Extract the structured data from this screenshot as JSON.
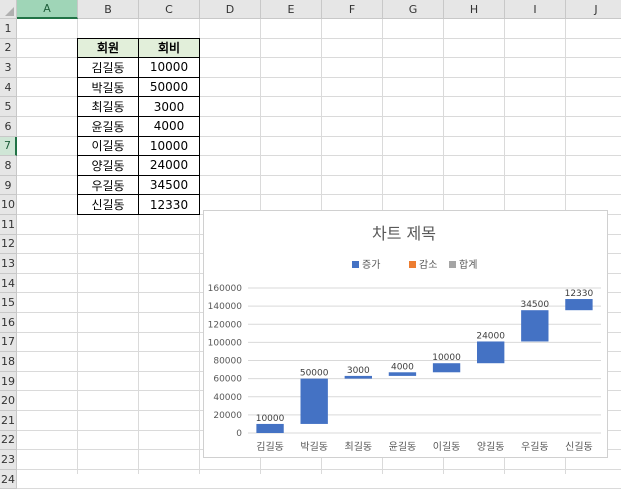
{
  "sheet": {
    "columns": [
      "A",
      "B",
      "C",
      "D",
      "E",
      "F",
      "G",
      "H",
      "I",
      "J"
    ],
    "rows": [
      "1",
      "2",
      "3",
      "4",
      "5",
      "6",
      "7",
      "8",
      "9",
      "10",
      "11",
      "12",
      "13",
      "14",
      "15",
      "16",
      "17",
      "18",
      "19",
      "20",
      "21",
      "22",
      "23",
      "24"
    ],
    "selected_column": "A",
    "selected_row": "7"
  },
  "table": {
    "header": [
      "회원",
      "회비"
    ],
    "rows": [
      [
        "김길동",
        "10000"
      ],
      [
        "박길동",
        "50000"
      ],
      [
        "최길동",
        "3000"
      ],
      [
        "윤길동",
        "4000"
      ],
      [
        "이길동",
        "10000"
      ],
      [
        "양길동",
        "24000"
      ],
      [
        "우길동",
        "34500"
      ],
      [
        "신길동",
        "12330"
      ]
    ]
  },
  "chart_data": {
    "type": "bar",
    "subtype": "waterfall",
    "title": "차트 제목",
    "legend": [
      {
        "name": "증가",
        "color": "#4472c4"
      },
      {
        "name": "감소",
        "color": "#ed7d31"
      },
      {
        "name": "합계",
        "color": "#a5a5a5"
      }
    ],
    "legend_position": "top",
    "categories": [
      "김길동",
      "박길동",
      "최길동",
      "윤길동",
      "이길동",
      "양길동",
      "우길동",
      "신길동"
    ],
    "values": [
      10000,
      50000,
      3000,
      4000,
      10000,
      24000,
      34500,
      12330
    ],
    "data_labels": [
      "10000",
      "50000",
      "3000",
      "4000",
      "10000",
      "24000",
      "34500",
      "12330"
    ],
    "y_ticks": [
      "0",
      "20000",
      "40000",
      "60000",
      "80000",
      "100000",
      "120000",
      "140000",
      "160000"
    ],
    "ylim": [
      0,
      160000
    ],
    "grid": true
  }
}
